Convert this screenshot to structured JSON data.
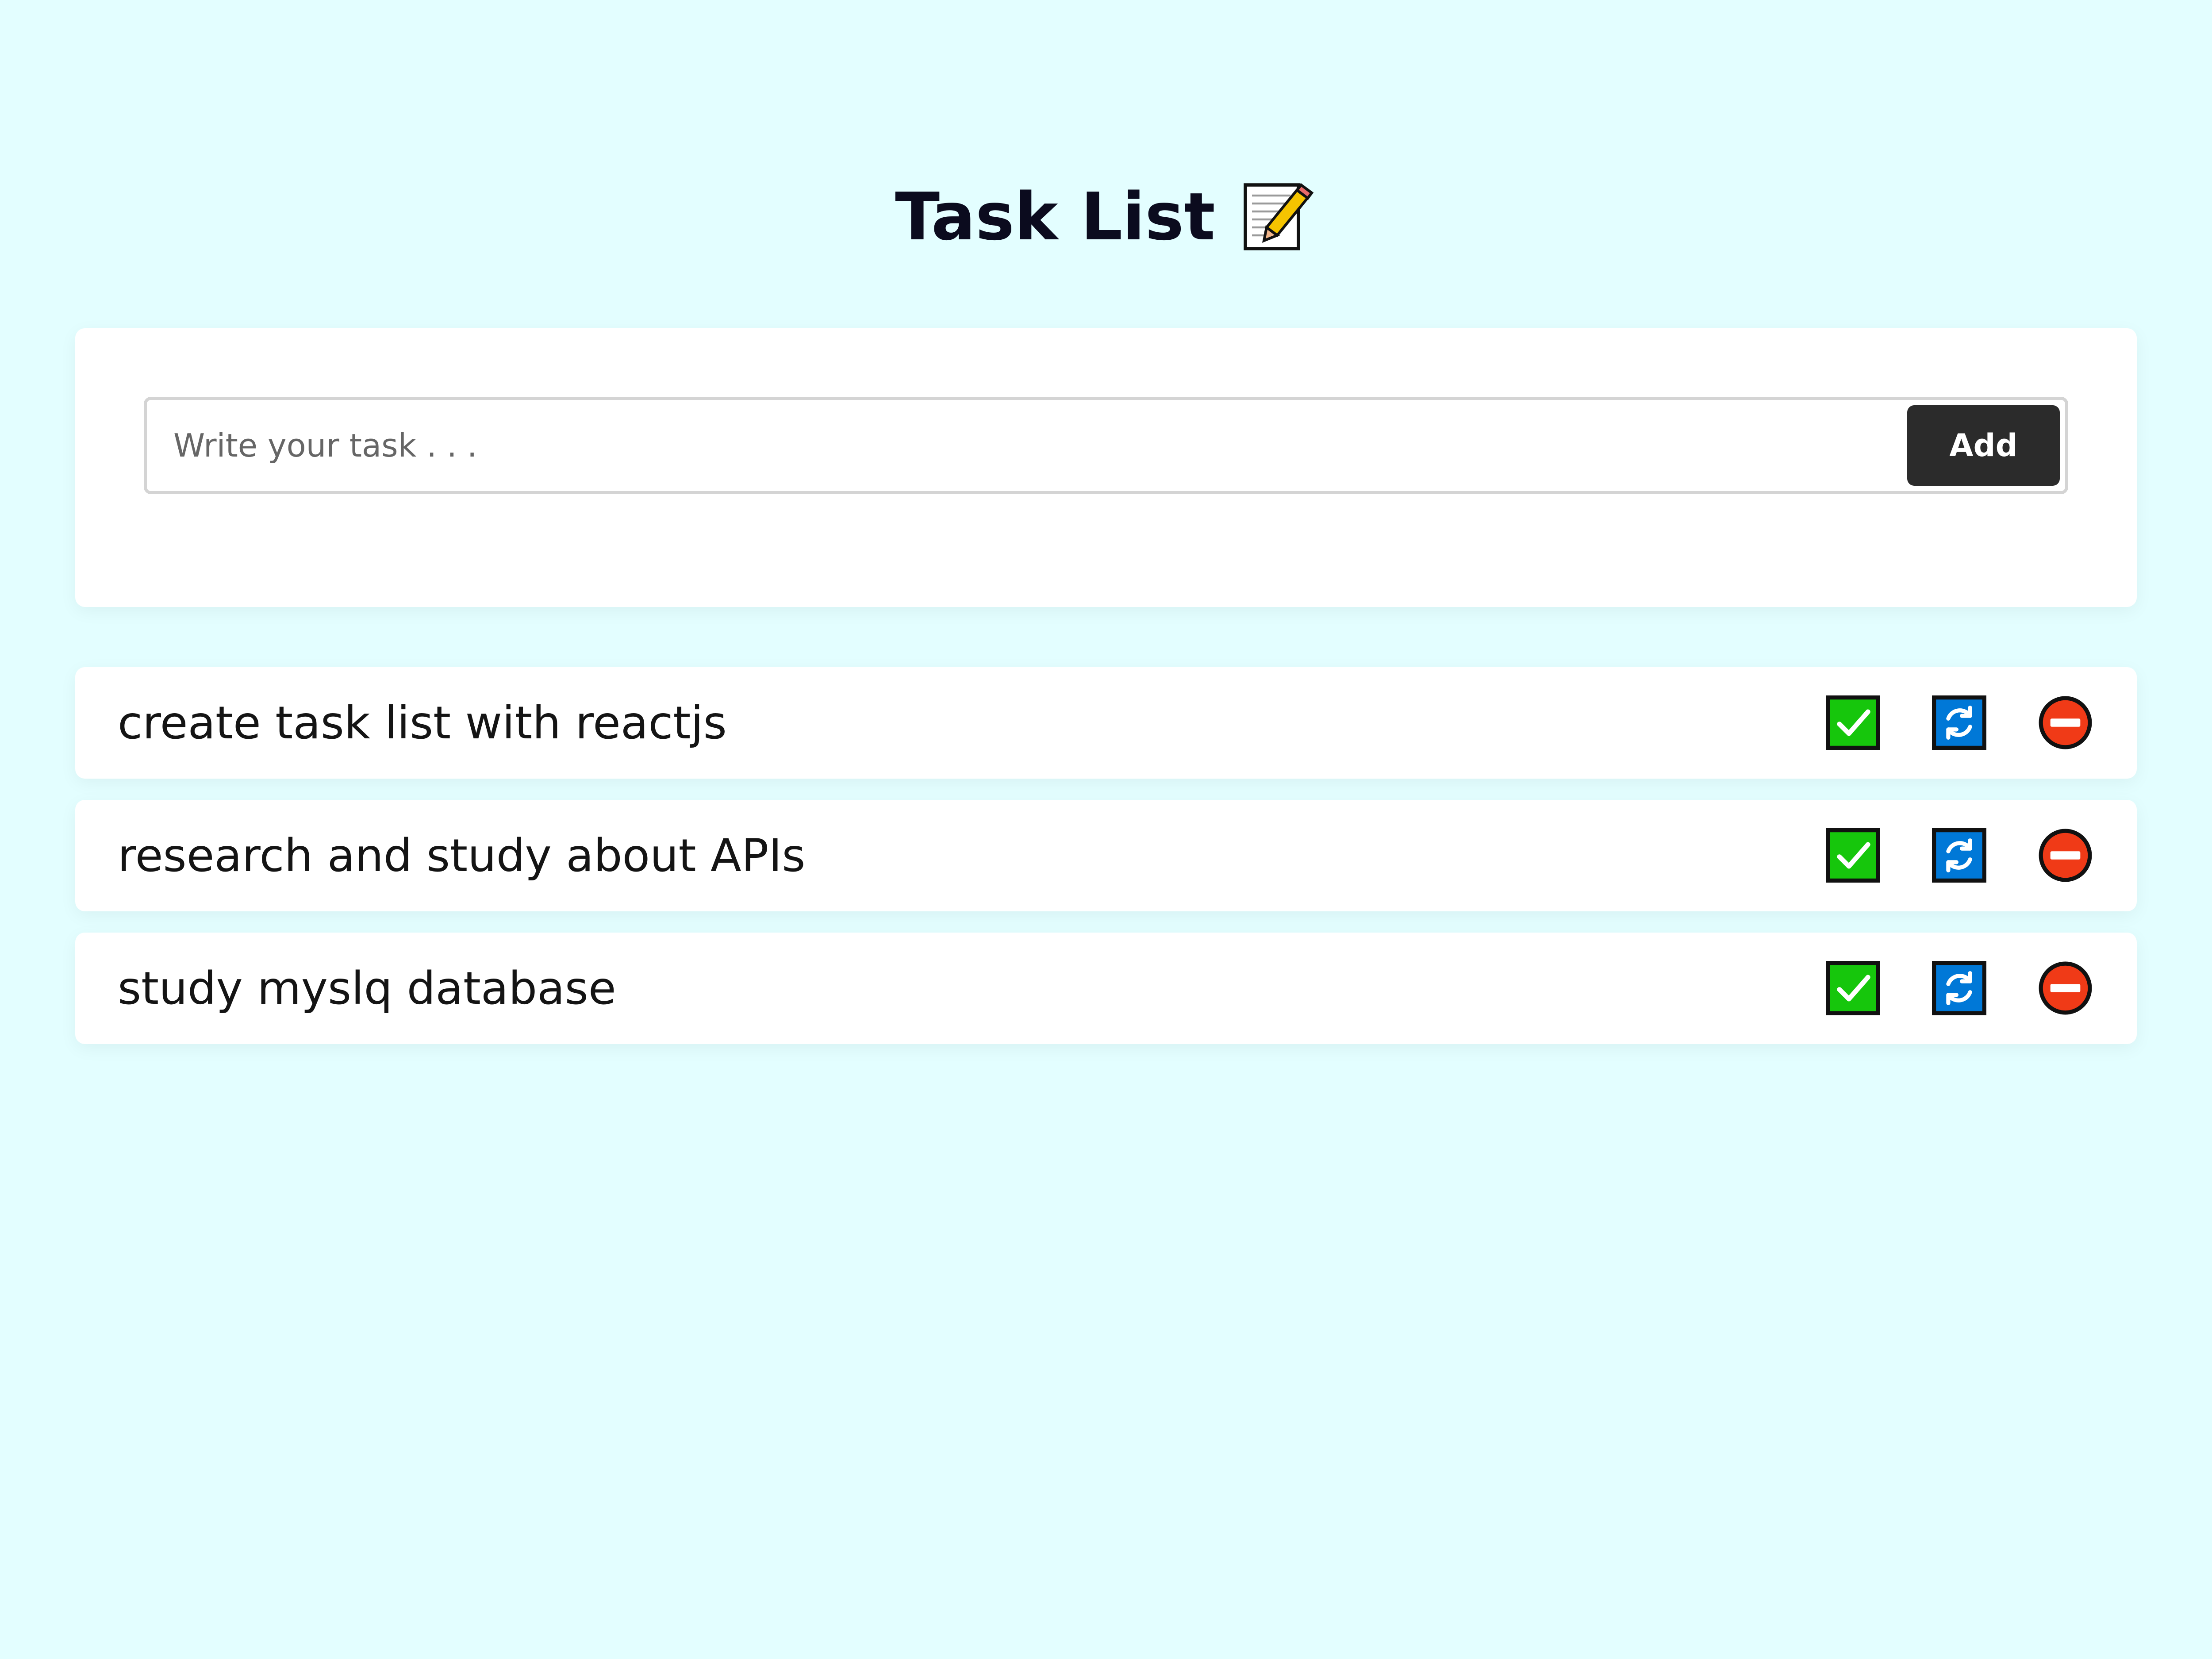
{
  "header": {
    "title": "Task List",
    "title_icon": "notepad-pencil-icon"
  },
  "input": {
    "placeholder": "Write your task . . .",
    "value": "",
    "add_label": "Add"
  },
  "tasks": [
    {
      "text": "create task list with reactjs",
      "actions": [
        "check-icon",
        "refresh-icon",
        "remove-icon"
      ]
    },
    {
      "text": "research and study about APIs",
      "actions": [
        "check-icon",
        "refresh-icon",
        "remove-icon"
      ]
    },
    {
      "text": "study myslq database",
      "actions": [
        "check-icon",
        "refresh-icon",
        "remove-icon"
      ]
    }
  ],
  "colors": {
    "background": "#e3feff",
    "card": "#ffffff",
    "button": "#2b2b2b",
    "complete": "#16c60c",
    "update": "#0078d7",
    "delete": "#f03a17"
  }
}
